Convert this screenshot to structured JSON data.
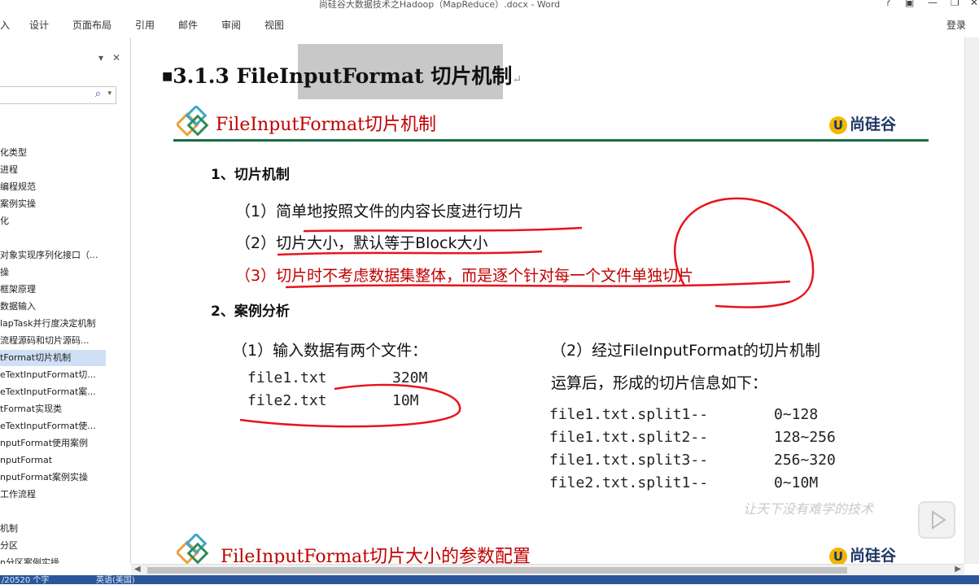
{
  "window": {
    "title": "尚硅谷大数据技术之Hadoop（MapReduce）.docx - Word",
    "controls": [
      "?",
      "▣",
      "—",
      "❐",
      "✕"
    ]
  },
  "ribbon": {
    "tabs": [
      "入",
      "设计",
      "页面布局",
      "引用",
      "邮件",
      "审阅",
      "视图"
    ],
    "login": "登录"
  },
  "nav": {
    "items": [
      {
        "label": "化类型"
      },
      {
        "label": "进程"
      },
      {
        "label": "编程规范"
      },
      {
        "label": "案例实操"
      },
      {
        "label": "化"
      },
      {
        "label": ""
      },
      {
        "label": "对象实现序列化接口（..."
      },
      {
        "label": "操"
      },
      {
        "label": "框架原理"
      },
      {
        "label": "数据输入"
      },
      {
        "label": "lapTask并行度决定机制"
      },
      {
        "label": "流程源码和切片源码..."
      },
      {
        "label": "tFormat切片机制",
        "selected": true
      },
      {
        "label": "eTextInputFormat切..."
      },
      {
        "label": "eTextInputFormat案..."
      },
      {
        "label": "tFormat实现类"
      },
      {
        "label": "eTextInputFormat使..."
      },
      {
        "label": "nputFormat使用案例"
      },
      {
        "label": "nputFormat"
      },
      {
        "label": "nputFormat案例实操"
      },
      {
        "label": "工作流程"
      },
      {
        "label": ""
      },
      {
        "label": "机制"
      },
      {
        "label": "分区"
      },
      {
        "label": "n分区案例实操"
      }
    ]
  },
  "doc": {
    "heading": "3.1.3 FileInputFormat 切片机制",
    "slide1": {
      "title": "FileInputFormat切片机制",
      "brand": "尚硅谷",
      "sec1": "1、切片机制",
      "points": [
        "（1）简单地按照文件的内容长度进行切片",
        "（2）切片大小，默认等于Block大小",
        "（3）切片时不考虑数据集整体，而是逐个针对每一个文件单独切片"
      ],
      "sec2": "2、案例分析",
      "input_title": "（1）输入数据有两个文件：",
      "files": [
        {
          "name": "file1.txt",
          "size": "320M"
        },
        {
          "name": "file2.txt",
          "size": "10M"
        }
      ],
      "result_title_1": "（2）经过FileInputFormat的切片机制",
      "result_title_2": "运算后，形成的切片信息如下：",
      "splits": [
        {
          "name": "file1.txt.split1--",
          "range": "0~128"
        },
        {
          "name": "file1.txt.split2--",
          "range": "128~256"
        },
        {
          "name": "file1.txt.split3--",
          "range": "256~320"
        },
        {
          "name": "file2.txt.split1--",
          "range": "0~10M"
        }
      ]
    },
    "slide2": {
      "title": "FileInputFormat切片大小的参数配置",
      "brand": "尚硅谷"
    },
    "watermark": "让天下没有难学的技术"
  },
  "statusbar": {
    "words": "/20520 个字",
    "lang": "英语(美国)"
  },
  "colors": {
    "accent": "#2b579a",
    "slide_title": "#c00000",
    "rule": "#1a6b45",
    "annotation": "#e8141b"
  }
}
